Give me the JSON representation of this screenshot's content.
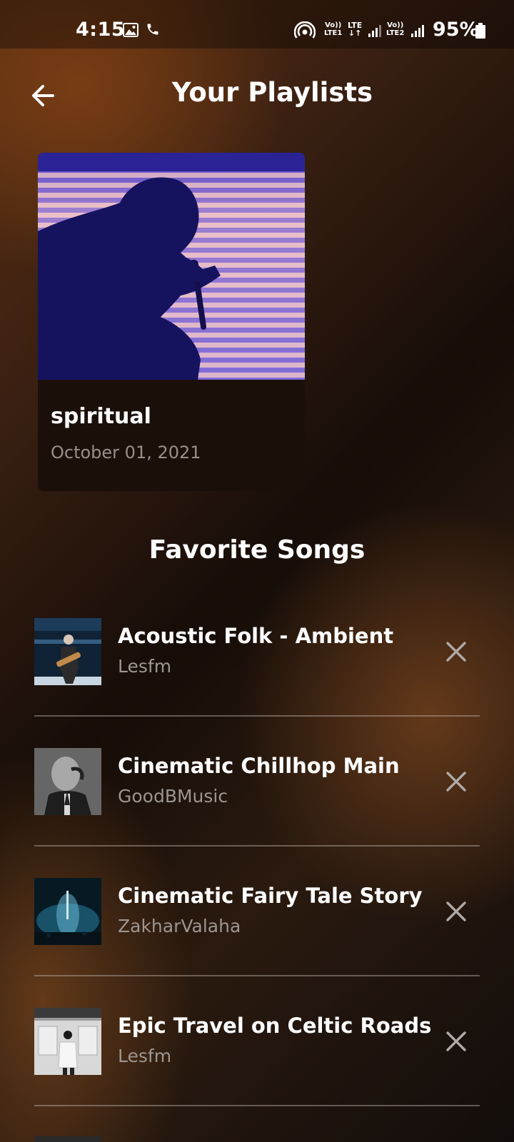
{
  "status_bar": {
    "time": "4:15",
    "battery": "95%",
    "sim1_label": "Vo))\nLTE1",
    "network_label": "LTE\n↓↑",
    "sim2_label": "Vo))\nLTE2",
    "icons": [
      "gallery-icon",
      "phone-icon",
      "hotspot-icon",
      "signal-icon",
      "signal-icon",
      "battery-icon"
    ]
  },
  "header": {
    "title": "Your Playlists",
    "back_icon": "arrow-left-icon"
  },
  "playlist": {
    "name": "spiritual",
    "date": "October 01, 2021"
  },
  "favorites": {
    "title": "Favorite Songs",
    "remove_icon": "close-icon",
    "songs": [
      {
        "title": "Acoustic Folk - Ambient",
        "artist": "Lesfm"
      },
      {
        "title": "Cinematic Chillhop Main",
        "artist": "GoodBMusic"
      },
      {
        "title": "Cinematic Fairy Tale Story",
        "artist": "ZakharValaha"
      },
      {
        "title": "Epic Travel on Celtic Roads -",
        "artist": "Lesfm"
      }
    ]
  },
  "colors": {
    "text": "#ffffff",
    "muted": "#9d9590",
    "card": "#1b0f0a",
    "accent_brown": "#5a2f12"
  }
}
